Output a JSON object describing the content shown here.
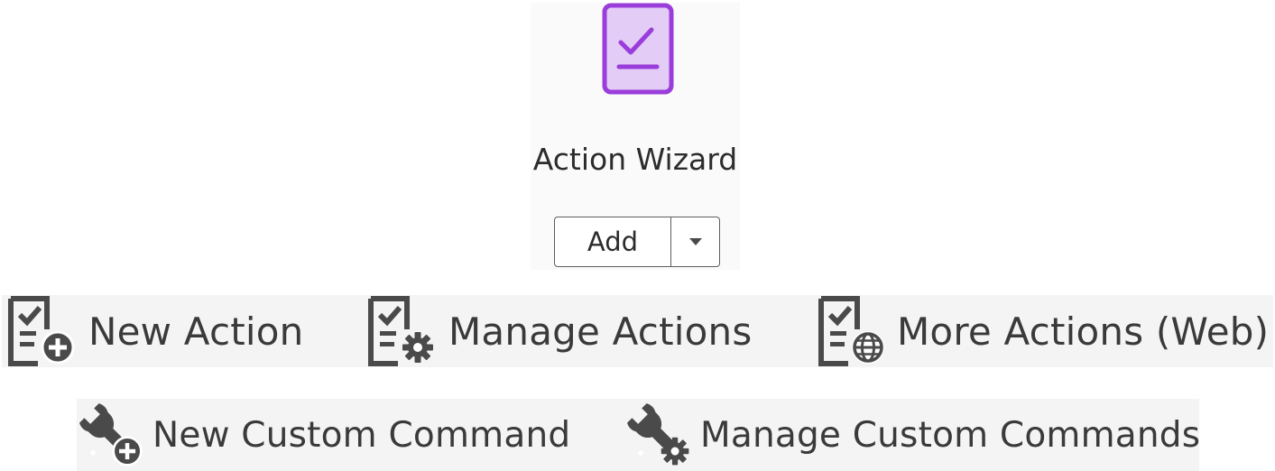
{
  "tool": {
    "title": "Action Wizard",
    "icon": "checklist-document-icon",
    "accent_color": "#9a3ddb",
    "accent_fill": "#e3ccf5",
    "add_label": "Add",
    "dropdown_icon": "caret-down-icon"
  },
  "actions_row": {
    "items": [
      {
        "label": "New Action",
        "icon": "new-action-icon"
      },
      {
        "label": "Manage Actions",
        "icon": "manage-actions-icon"
      },
      {
        "label": "More Actions (Web)",
        "icon": "more-actions-web-icon"
      }
    ]
  },
  "commands_row": {
    "items": [
      {
        "label": "New Custom Command",
        "icon": "new-custom-command-icon"
      },
      {
        "label": "Manage Custom Commands",
        "icon": "manage-custom-commands-icon"
      }
    ]
  },
  "icon_color": "#4a4a4a"
}
